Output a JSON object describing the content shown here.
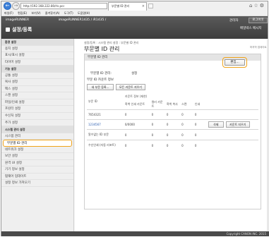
{
  "browser": {
    "address": "http://192.168.222.80/rls.pcc",
    "tab_title": "부문별 ID 관리",
    "menu": [
      "파일(F)",
      "편집(E)",
      "보기(V)",
      "즐겨찾기(A)",
      "도구(T)",
      "도움말(H)"
    ]
  },
  "header": {
    "model_left": "imageRUNNER",
    "model_right": "imageRUNNER1435 / iR1435 /",
    "app_title": "설정/등록",
    "manager": "관리자",
    "logout": "로그아웃",
    "mailbox": "메일박스 메시지"
  },
  "sidebar": {
    "items": [
      {
        "label": "환경 설정",
        "head": true
      },
      {
        "label": "용지 설정"
      },
      {
        "label": "표시/표시 설정"
      },
      {
        "label": "타이머 설정"
      },
      {
        "label": "기능 설정",
        "head": true
      },
      {
        "label": "공통 설정"
      },
      {
        "label": "복사 설정"
      },
      {
        "label": "팩스 설정"
      },
      {
        "label": "스캔 설정"
      },
      {
        "label": "파일/인쇄 설정"
      },
      {
        "label": "프린터 설정"
      },
      {
        "label": "수신처 설정"
      },
      {
        "label": "추가 설정"
      },
      {
        "label": "시스템 관리 설정",
        "head": true
      },
      {
        "label": "시스템 관리"
      },
      {
        "label": "부문별 ID 관리",
        "selected": true
      },
      {
        "label": "네트워크 설정"
      },
      {
        "label": "보안 설정"
      },
      {
        "label": "원격 UI 설정"
      },
      {
        "label": "기기 정보 설정"
      },
      {
        "label": "펌웨어 업데이트"
      },
      {
        "label": "설정 정보 가져오기"
      }
    ]
  },
  "main": {
    "breadcrumb": "설정/등록 : 시스템 관리 설정 : 부문별 ID 관리",
    "title": "부문별 ID 관리",
    "last_updated": "마지막 업데이트",
    "section_title": "부문별 ID 관리",
    "edit_button": "편집...",
    "dept_id_mgmt_label": "부문별 ID 관리:",
    "dept_id_mgmt_value": "설정",
    "list_title": "부문 ID 카운트 정보",
    "register_button": "새 부문 등록...",
    "clear_all_button": "모든 카운트 지우기",
    "table": {
      "col_id": "부문 ID",
      "col_group": "카운트 정보 (제한)",
      "cols": [
        "흑백 인쇄 카운트",
        "컬러 카운트",
        "흑백 복사",
        "스캔",
        "인쇄"
      ],
      "rows": [
        {
          "id": "7654321",
          "link": false,
          "values": [
            "0",
            "0",
            "0",
            "0",
            "0"
          ],
          "actions": false
        },
        {
          "id": "1234567",
          "link": true,
          "values": [
            "0/0000",
            "0",
            "0",
            "0",
            "0"
          ],
          "actions": true
        },
        {
          "id": "알수없는 ID 부문",
          "link": false,
          "values": [
            "0",
            "0",
            "0",
            "0",
            "0"
          ],
          "actions": false
        },
        {
          "id": "수신인쇄 (자동 리포트)",
          "link": false,
          "values": [
            "0",
            "0",
            "0",
            "0",
            "0"
          ],
          "actions": false
        }
      ],
      "delete_button": "삭제",
      "clear_count_button": "카운트 지우기"
    }
  },
  "footer": {
    "copyright": "Copyright CANON INC. 2015"
  }
}
